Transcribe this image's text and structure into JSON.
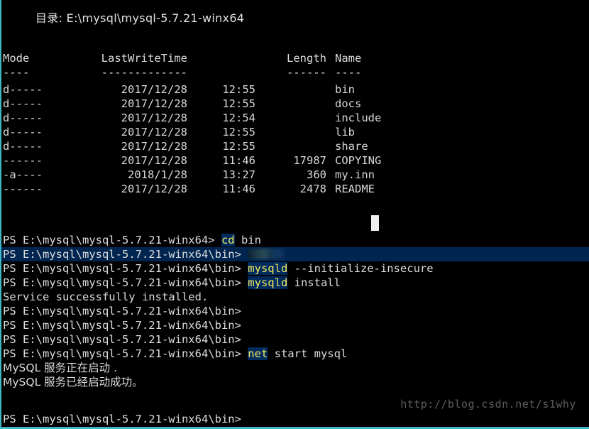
{
  "terminal": {
    "shell": "PowerShell",
    "colors": {
      "background": "#000000",
      "foreground": "#d8d8d8",
      "border": "#3fb8c4",
      "selection_bg": "#002550",
      "command_highlight_fg": "#f2e85c",
      "command_highlight_bg": "#002b5e",
      "cursor": "#f0f0f0",
      "watermark": "#5d5d5d"
    },
    "directory_header": {
      "label": "目录:",
      "path": "E:\\mysql\\mysql-5.7.21-winx64",
      "full_text": "目录: E:\\mysql\\mysql-5.7.21-winx64"
    },
    "listing": {
      "columns": [
        "Mode",
        "LastWriteTime",
        "Length",
        "Name"
      ],
      "underlines": [
        "----",
        "-------------",
        "------",
        "----"
      ],
      "rows": [
        {
          "mode": "d-----",
          "date": "2017/12/28",
          "time": "12:55",
          "length": "",
          "name": "bin"
        },
        {
          "mode": "d-----",
          "date": "2017/12/28",
          "time": "12:55",
          "length": "",
          "name": "docs"
        },
        {
          "mode": "d-----",
          "date": "2017/12/28",
          "time": "12:54",
          "length": "",
          "name": "include"
        },
        {
          "mode": "d-----",
          "date": "2017/12/28",
          "time": "12:55",
          "length": "",
          "name": "lib"
        },
        {
          "mode": "d-----",
          "date": "2017/12/28",
          "time": "12:55",
          "length": "",
          "name": "share"
        },
        {
          "mode": "------",
          "date": "2017/12/28",
          "time": "11:46",
          "length": "17987",
          "name": "COPYING"
        },
        {
          "mode": "-a----",
          "date": "2018/1/28",
          "time": "13:27",
          "length": "360",
          "name": "my.inn"
        },
        {
          "mode": "------",
          "date": "2017/12/28",
          "time": "11:46",
          "length": "2478",
          "name": "README"
        }
      ]
    },
    "session": {
      "prompt_root": "PS E:\\mysql\\mysql-5.7.21-winx64>",
      "prompt_bin": "PS E:\\mysql\\mysql-5.7.21-winx64\\bin>",
      "lines": [
        {
          "type": "command",
          "prompt": "PS E:\\mysql\\mysql-5.7.21-winx64>",
          "cmd": "cd",
          "args": " bin"
        },
        {
          "type": "selected",
          "prompt": "PS E:\\mysql\\mysql-5.7.21-winx64\\bin>",
          "cmd": "",
          "args": "",
          "redacted": true
        },
        {
          "type": "command",
          "prompt": "PS E:\\mysql\\mysql-5.7.21-winx64\\bin>",
          "cmd": "mysqld",
          "args": " --initialize-insecure"
        },
        {
          "type": "command",
          "prompt": "PS E:\\mysql\\mysql-5.7.21-winx64\\bin>",
          "cmd": "mysqld",
          "args": " install"
        },
        {
          "type": "output",
          "text": "Service successfully installed."
        },
        {
          "type": "prompt_only",
          "prompt": "PS E:\\mysql\\mysql-5.7.21-winx64\\bin>"
        },
        {
          "type": "prompt_only",
          "prompt": "PS E:\\mysql\\mysql-5.7.21-winx64\\bin>"
        },
        {
          "type": "prompt_only",
          "prompt": "PS E:\\mysql\\mysql-5.7.21-winx64\\bin>"
        },
        {
          "type": "command",
          "prompt": "PS E:\\mysql\\mysql-5.7.21-winx64\\bin>",
          "cmd": "net",
          "args": " start mysql"
        },
        {
          "type": "output",
          "text": "MySQL 服务正在启动 ."
        },
        {
          "type": "output",
          "text": "MySQL 服务已经启动成功。"
        },
        {
          "type": "blank",
          "text": ""
        },
        {
          "type": "prompt_only",
          "prompt": "PS E:\\mysql\\mysql-5.7.21-winx64\\bin>"
        }
      ]
    },
    "watermark": "http://blog.csdn.net/s1why"
  }
}
